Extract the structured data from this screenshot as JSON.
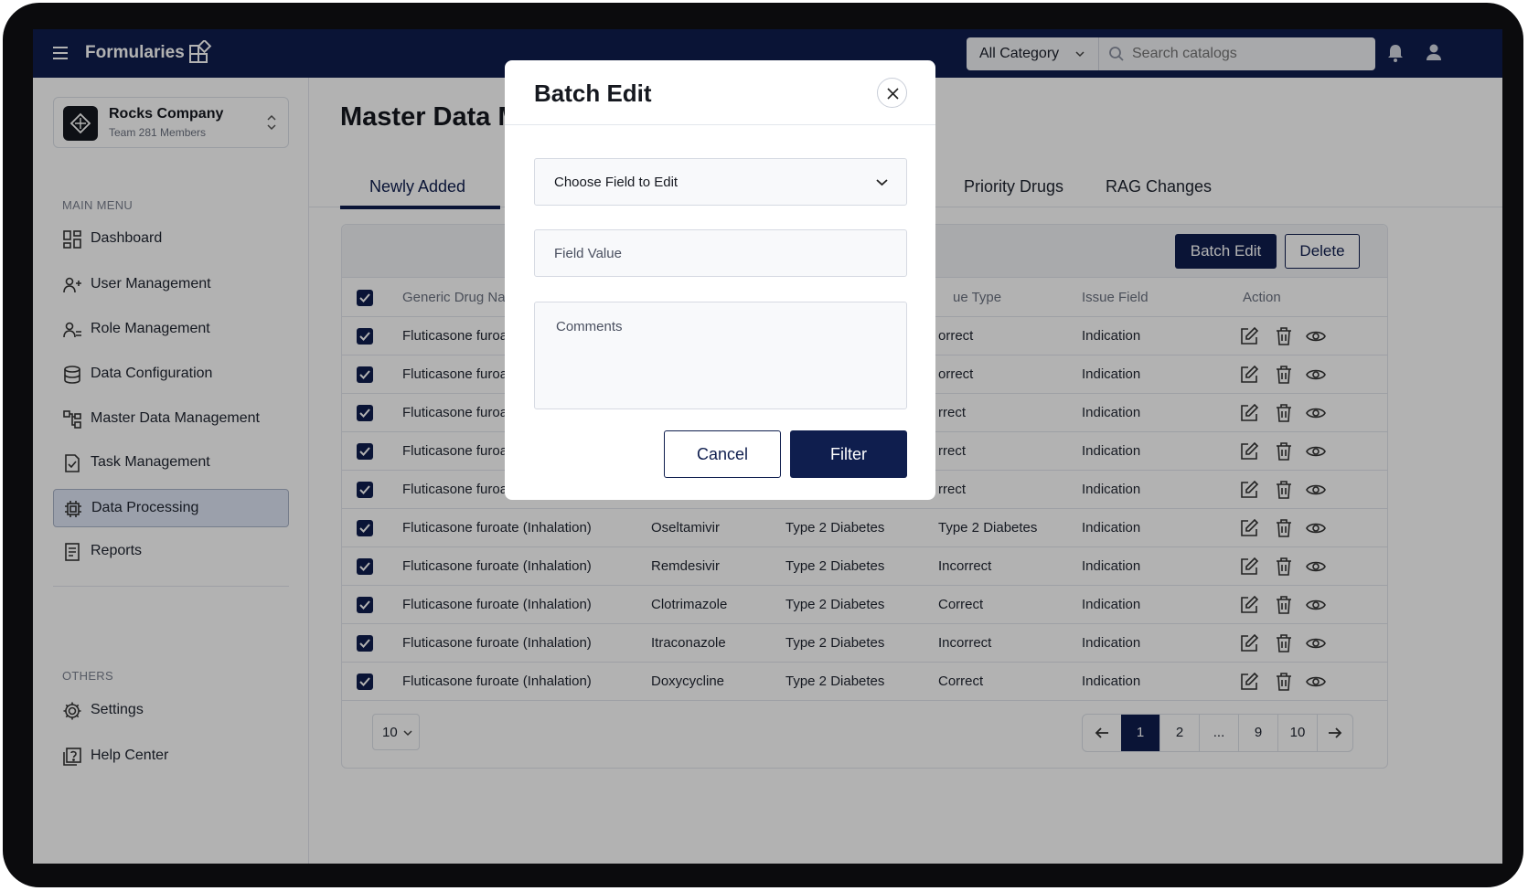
{
  "app": {
    "title": "Formularies",
    "category_select": "All Category",
    "search_placeholder": "Search catalogs"
  },
  "sidebar": {
    "company_name": "Rocks Company",
    "company_sub": "Team 281 Members",
    "main_menu_label": "MAIN MENU",
    "others_label": "OTHERS",
    "items": [
      {
        "label": "Dashboard",
        "icon": "dashboard-icon"
      },
      {
        "label": "User Management",
        "icon": "user-management-icon"
      },
      {
        "label": "Role Management",
        "icon": "role-management-icon"
      },
      {
        "label": "Data Configuration",
        "icon": "database-icon"
      },
      {
        "label": "Master Data Management",
        "icon": "hierarchy-icon"
      },
      {
        "label": "Task Management",
        "icon": "task-icon"
      },
      {
        "label": "Data Processing",
        "icon": "processor-icon",
        "active": true
      },
      {
        "label": "Reports",
        "icon": "report-icon"
      }
    ],
    "others": [
      {
        "label": "Settings",
        "icon": "gear-icon"
      },
      {
        "label": "Help Center",
        "icon": "help-icon"
      }
    ]
  },
  "main": {
    "title": "Master Data Ma",
    "tabs": [
      "Newly Added",
      "Priority Drugs",
      "RAG Changes"
    ],
    "batch_edit_label": "Batch Edit",
    "delete_label": "Delete",
    "columns": [
      "Generic Drug Name",
      "ue Type",
      "Issue Field",
      "Action"
    ],
    "rows": [
      {
        "drug": "Fluticasone furoate",
        "c2": "",
        "c3": "",
        "issue_type": "orrect",
        "issue_field": "Indication"
      },
      {
        "drug": "Fluticasone furoate",
        "c2": "",
        "c3": "",
        "issue_type": "orrect",
        "issue_field": "Indication"
      },
      {
        "drug": "Fluticasone furoate",
        "c2": "",
        "c3": "",
        "issue_type": "rrect",
        "issue_field": "Indication"
      },
      {
        "drug": "Fluticasone furoate",
        "c2": "",
        "c3": "",
        "issue_type": "rrect",
        "issue_field": "Indication"
      },
      {
        "drug": "Fluticasone furoate",
        "c2": "",
        "c3": "",
        "issue_type": "rrect",
        "issue_field": "Indication"
      },
      {
        "drug": "Fluticasone furoate (Inhalation)",
        "c2": "Oseltamivir",
        "c3": "Type 2 Diabetes",
        "issue_type": "Type 2 Diabetes",
        "issue_field": "Indication"
      },
      {
        "drug": "Fluticasone furoate (Inhalation)",
        "c2": "Remdesivir",
        "c3": "Type 2 Diabetes",
        "issue_type": "Incorrect",
        "issue_field": "Indication"
      },
      {
        "drug": "Fluticasone furoate (Inhalation)",
        "c2": "Clotrimazole",
        "c3": "Type 2 Diabetes",
        "issue_type": "Correct",
        "issue_field": "Indication"
      },
      {
        "drug": "Fluticasone furoate (Inhalation)",
        "c2": "Itraconazole",
        "c3": "Type 2 Diabetes",
        "issue_type": "Incorrect",
        "issue_field": "Indication"
      },
      {
        "drug": "Fluticasone furoate (Inhalation)",
        "c2": "Doxycycline",
        "c3": "Type 2 Diabetes",
        "issue_type": "Correct",
        "issue_field": "Indication"
      }
    ],
    "page_size": "10",
    "pages": [
      "1",
      "2",
      "...",
      "9",
      "10"
    ],
    "current_page": "1"
  },
  "modal": {
    "title": "Batch Edit",
    "field_select": "Choose Field to Edit",
    "field_value_placeholder": "Field Value",
    "comments_placeholder": "Comments",
    "cancel_label": "Cancel",
    "filter_label": "Filter"
  },
  "colors": {
    "primary": "#0f1e4e",
    "overlay": "rgba(0,0,0,0.30)"
  }
}
